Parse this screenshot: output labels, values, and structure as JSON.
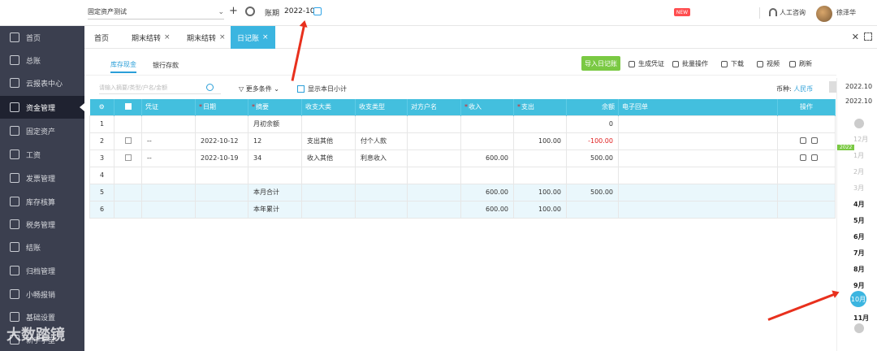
{
  "header": {
    "company": "固定资产测试",
    "period_label": "账期",
    "period_value": "2022-10",
    "badge": "NEW",
    "support": "人工咨询",
    "user": "徐泽华"
  },
  "sidebar": {
    "items": [
      "首页",
      "总账",
      "云报表中心",
      "资金管理",
      "固定资产",
      "工资",
      "发票管理",
      "库存核算",
      "税务管理",
      "结账",
      "归档管理",
      "小畅报销",
      "基础设置",
      "新手学堂"
    ]
  },
  "tabs": [
    "首页",
    "期末结转",
    "期末结转",
    "日记账"
  ],
  "subtabs": [
    "库存现金",
    "银行存款"
  ],
  "actions": {
    "import": "导入日记账",
    "gen_voucher": "生成凭证",
    "batch": "批量操作",
    "download": "下载",
    "video": "视频",
    "refresh": "刷新"
  },
  "filters": {
    "search_placeholder": "请输入摘要/类型/户名/金额",
    "more": "更多条件",
    "show_daily": "显示本日小计",
    "currency_label": "币种:",
    "currency_value": "人民币"
  },
  "table": {
    "headers": [
      "",
      "",
      "凭证",
      "日期",
      "摘要",
      "收支大类",
      "收支类型",
      "对方户名",
      "收入",
      "支出",
      "余额",
      "电子回单",
      "操作"
    ],
    "rows": [
      {
        "no": "1",
        "voucher": "",
        "date": "",
        "summary": "月初余额",
        "cat": "",
        "type": "",
        "party": "",
        "income": "",
        "expense": "",
        "balance": "0",
        "ops": false,
        "sum": false
      },
      {
        "no": "2",
        "voucher": "--",
        "date": "2022-10-12",
        "summary": "12",
        "cat": "支出其他",
        "type": "付个人款",
        "party": "",
        "income": "",
        "expense": "100.00",
        "balance": "-100.00",
        "ops": true,
        "sum": false
      },
      {
        "no": "3",
        "voucher": "--",
        "date": "2022-10-19",
        "summary": "34",
        "cat": "收入其他",
        "type": "利息收入",
        "party": "",
        "income": "600.00",
        "expense": "",
        "balance": "500.00",
        "ops": true,
        "sum": false
      },
      {
        "no": "4",
        "voucher": "",
        "date": "",
        "summary": "",
        "cat": "",
        "type": "",
        "party": "",
        "income": "",
        "expense": "",
        "balance": "",
        "ops": false,
        "sum": false
      },
      {
        "no": "5",
        "voucher": "",
        "date": "",
        "summary": "本月合计",
        "cat": "",
        "type": "",
        "party": "",
        "income": "600.00",
        "expense": "100.00",
        "balance": "500.00",
        "ops": false,
        "sum": true
      },
      {
        "no": "6",
        "voucher": "",
        "date": "",
        "summary": "本年累计",
        "cat": "",
        "type": "",
        "party": "",
        "income": "600.00",
        "expense": "100.00",
        "balance": "",
        "ops": false,
        "sum": true
      }
    ]
  },
  "period_panel": {
    "from": "2022.10",
    "to": "2022.10",
    "prev_month": "12月",
    "year_badge": "2022",
    "months": [
      "1月",
      "2月",
      "3月",
      "4月",
      "5月",
      "6月",
      "7月",
      "8月",
      "9月",
      "10月",
      "11月"
    ],
    "selected_month": "10月"
  },
  "watermark": "大数踏镜"
}
